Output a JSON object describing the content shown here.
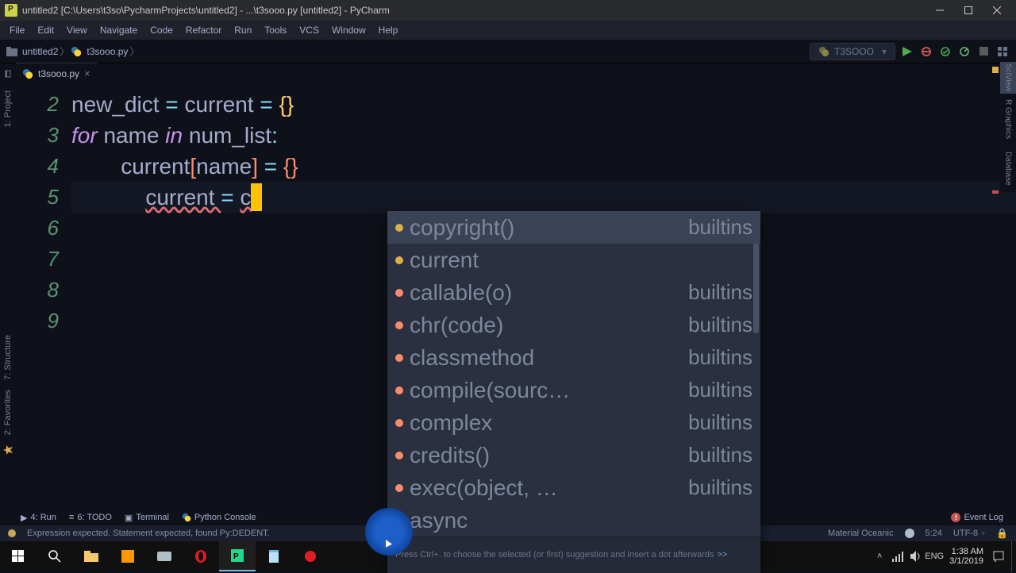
{
  "titlebar": {
    "text": "untitled2 [C:\\Users\\t3so\\PycharmProjects\\untitled2] - ...\\t3sooo.py [untitled2] - PyCharm"
  },
  "menu": {
    "items": [
      "File",
      "Edit",
      "View",
      "Navigate",
      "Code",
      "Refactor",
      "Run",
      "Tools",
      "VCS",
      "Window",
      "Help"
    ]
  },
  "breadcrumb": {
    "project": "untitled2",
    "file": "t3sooo.py"
  },
  "runConfig": {
    "name": "T3SOOO"
  },
  "tab": {
    "file": "t3sooo.py"
  },
  "gutterLines": [
    "2",
    "3",
    "4",
    "5",
    "6",
    "7",
    "8",
    "9"
  ],
  "code": {
    "line2": {
      "a": "new_dict ",
      "b": "= ",
      "c": "current ",
      "d": "= ",
      "e": "{}"
    },
    "line3": {
      "a": "for ",
      "b": "name ",
      "c": "in ",
      "d": "num_list",
      "e": ":"
    },
    "line4": {
      "indent": "        ",
      "a": "current",
      "b": "[",
      "c": "name",
      "d": "] ",
      "e": "= ",
      "f": "{}"
    },
    "line5": {
      "indent": "            ",
      "a": "current ",
      "b": "= ",
      "c": "c"
    }
  },
  "autocomplete": {
    "rows": [
      {
        "name": "copyright()",
        "src": "builtins",
        "dot": "y",
        "sel": true
      },
      {
        "name": "current",
        "src": "",
        "dot": "y"
      },
      {
        "name": "callable(o)",
        "src": "builtins",
        "dot": "o"
      },
      {
        "name": "chr(code)",
        "src": "builtins",
        "dot": "o"
      },
      {
        "name": "classmethod",
        "src": "builtins",
        "dot": "o"
      },
      {
        "name": "compile(sourc…",
        "src": "builtins",
        "dot": "o"
      },
      {
        "name": "complex",
        "src": "builtins",
        "dot": "o"
      },
      {
        "name": "credits()",
        "src": "builtins",
        "dot": "o"
      },
      {
        "name": "exec(object, …",
        "src": "builtins",
        "dot": "o"
      },
      {
        "name": "async",
        "src": "",
        "dot": ""
      }
    ],
    "hint": "Press Ctrl+. to choose the selected (or first) suggestion and insert a dot afterwards",
    "hintLink": ">>"
  },
  "leftTabs": {
    "project": "1: Project",
    "structure": "7: Structure",
    "favorites": "2: Favorites"
  },
  "rightTabs": {
    "sciview": "SciView",
    "rplots": "R Graphics",
    "database": "Database"
  },
  "bottombar": {
    "run": "4: Run",
    "todo": "6: TODO",
    "terminal": "Terminal",
    "pyconsole": "Python Console",
    "eventlog": "Event Log"
  },
  "statusbar": {
    "msg": "Expression expected. Statement expected, found Py:DEDENT.",
    "theme": "Material Oceanic",
    "pos": "5:24",
    "encoding": "UTF-8",
    "lock": "🔒"
  },
  "systray": {
    "lang": "ENG",
    "time": "1:38 AM",
    "date": "3/1/2019"
  }
}
